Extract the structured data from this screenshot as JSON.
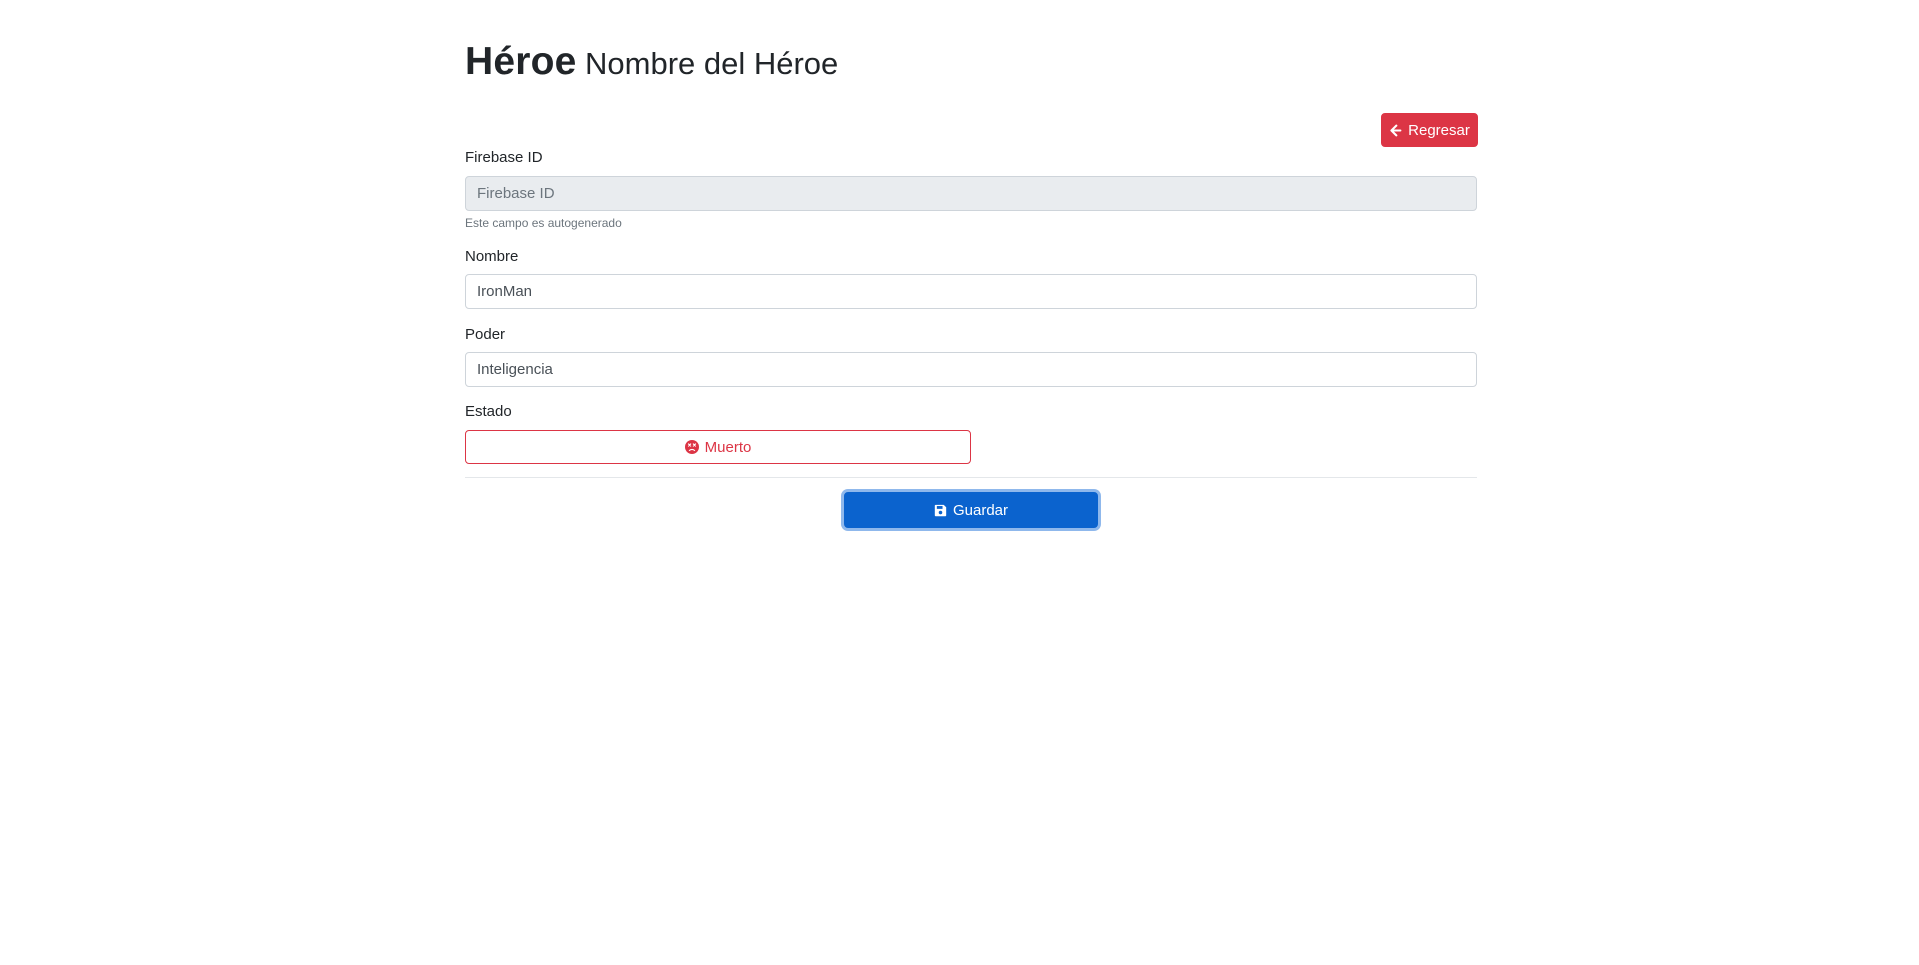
{
  "header": {
    "title": "Héroe",
    "subtitle": "Nombre del Héroe"
  },
  "back_button": {
    "label": "Regresar",
    "icon": "arrow-left-icon",
    "color": "#dc3545"
  },
  "form": {
    "firebase_id": {
      "label": "Firebase ID",
      "value": "",
      "placeholder": "Firebase ID",
      "help": "Este campo es autogenerado"
    },
    "nombre": {
      "label": "Nombre",
      "value": "IronMan"
    },
    "poder": {
      "label": "Poder",
      "value": "Inteligencia"
    },
    "estado": {
      "label": "Estado",
      "button_label": "Muerto",
      "icon": "sad-face-icon",
      "color": "#dc3545"
    },
    "save_button": {
      "label": "Guardar",
      "icon": "save-icon",
      "color": "#0b63ce"
    }
  }
}
